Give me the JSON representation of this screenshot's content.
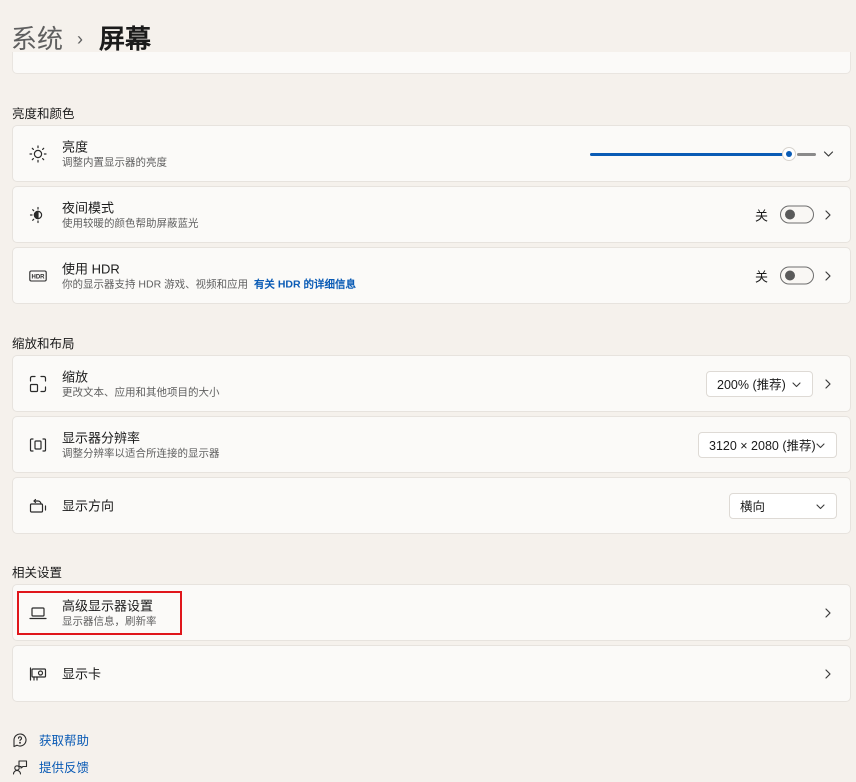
{
  "breadcrumb": {
    "parent": "系统",
    "separator": "›",
    "current": "屏幕"
  },
  "sections": {
    "brightness_color": "亮度和颜色",
    "scale_layout": "缩放和布局",
    "related": "相关设置"
  },
  "brightness": {
    "title": "亮度",
    "subtitle": "调整内置显示器的亮度",
    "level_percent": 88,
    "icon": "sun-icon"
  },
  "night_light": {
    "title": "夜间模式",
    "subtitle": "使用较暖的颜色帮助屏蔽蓝光",
    "state_label": "关",
    "icon": "night-light-icon"
  },
  "hdr": {
    "title": "使用 HDR",
    "subtitle": "你的显示器支持 HDR 游戏、视频和应用",
    "link": "有关 HDR 的详细信息",
    "state_label": "关",
    "icon": "hdr-icon"
  },
  "scale": {
    "title": "缩放",
    "subtitle": "更改文本、应用和其他项目的大小",
    "value": "200% (推荐)",
    "icon": "scale-icon"
  },
  "resolution": {
    "title": "显示器分辨率",
    "subtitle": "调整分辨率以适合所连接的显示器",
    "value": "3120 × 2080 (推荐)",
    "icon": "resolution-icon"
  },
  "orientation": {
    "title": "显示方向",
    "value": "横向",
    "icon": "orientation-icon"
  },
  "advanced_display": {
    "title": "高级显示器设置",
    "subtitle": "显示器信息，刷新率",
    "icon": "laptop-icon"
  },
  "graphics": {
    "title": "显示卡",
    "icon": "graphics-card-icon"
  },
  "footer": {
    "help": "获取帮助",
    "feedback": "提供反馈"
  },
  "colors": {
    "accent": "#0a5bb5",
    "highlight": "#e0161b",
    "background": "#f5f1ec",
    "card": "#fbfaf8"
  }
}
